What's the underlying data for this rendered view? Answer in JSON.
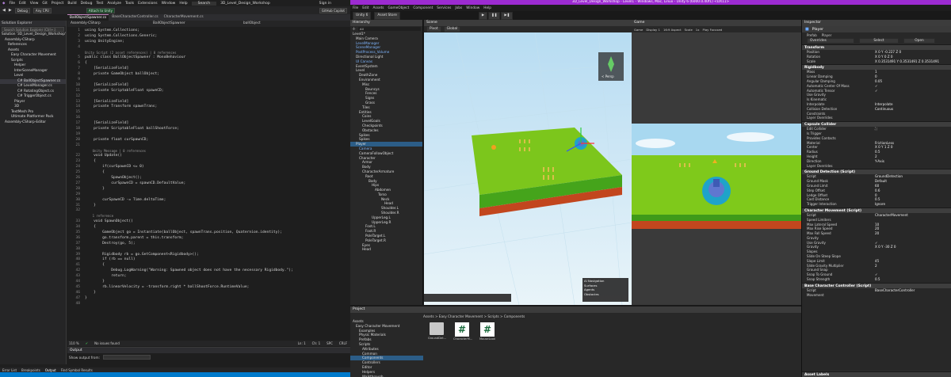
{
  "vs": {
    "title_menus": [
      "File",
      "Edit",
      "View",
      "Git",
      "Project",
      "Build",
      "Debug",
      "Test",
      "Analyze",
      "Tools",
      "Extensions",
      "Window",
      "Help"
    ],
    "search": "Search",
    "solution_name": "3D_Level_Design_Workshop",
    "sign_in": "Sign in",
    "toolbar": {
      "debug": "Debug",
      "cpu": "Any CPU",
      "attach": "Attach to Unity",
      "github": "GitHub Copilot"
    },
    "solution_explorer": {
      "title": "Solution Explorer",
      "search_placeholder": "Search Solution Explorer (Ctrl+;)",
      "tree": [
        {
          "d": 0,
          "t": "Solution '3D_Level_Design_Workshop'"
        },
        {
          "d": 1,
          "t": "Assembly-CSharp"
        },
        {
          "d": 2,
          "t": "References"
        },
        {
          "d": 2,
          "t": "Assets"
        },
        {
          "d": 3,
          "t": "Easy Character Movement"
        },
        {
          "d": 3,
          "t": "Scripts"
        },
        {
          "d": 4,
          "t": "Helper"
        },
        {
          "d": 4,
          "t": "InterSceneManager"
        },
        {
          "d": 4,
          "t": "Level"
        },
        {
          "d": 5,
          "t": "C# BallObjectSpawner.cs"
        },
        {
          "d": 5,
          "t": "C# LevelManager.cs"
        },
        {
          "d": 5,
          "t": "C# RotatingObject.cs"
        },
        {
          "d": 5,
          "t": "C# TriggerObject.cs"
        },
        {
          "d": 4,
          "t": "Player"
        },
        {
          "d": 4,
          "t": "3D"
        },
        {
          "d": 3,
          "t": "TextMesh Pro"
        },
        {
          "d": 3,
          "t": "Ultimate Platformer Pack"
        },
        {
          "d": 1,
          "t": "Assembly-CSharp-Editor"
        }
      ]
    },
    "tabs": [
      "BallObjectSpawner.cs",
      "BaseCharacterController.cs",
      "CharacterMovement.cs"
    ],
    "breadcrumb": [
      "Assembly-CSharp",
      "BallObjectSpawner",
      "ballObject"
    ],
    "code": [
      {
        "n": "1",
        "t": "using System.Collections;"
      },
      {
        "n": "2",
        "t": "using System.Collections.Generic;"
      },
      {
        "n": "3",
        "t": "using UnityEngine;"
      },
      {
        "n": "4",
        "t": ""
      },
      {
        "n": "",
        "t": "Unity Script (2 asset references) | 0 references",
        "hint": true
      },
      {
        "n": "5",
        "t": "public class BallObjectSpawner : MonoBehaviour"
      },
      {
        "n": "6",
        "t": "{"
      },
      {
        "n": "7",
        "t": "    [SerializeField]"
      },
      {
        "n": "8",
        "t": "    private GameObject ballObject;"
      },
      {
        "n": "9",
        "t": ""
      },
      {
        "n": "10",
        "t": "    [SerializeField]"
      },
      {
        "n": "11",
        "t": "    private ScriptableFloat spawnCD;"
      },
      {
        "n": "12",
        "t": ""
      },
      {
        "n": "13",
        "t": "    [SerializeField]"
      },
      {
        "n": "14",
        "t": "    private Transform spawnTrans;"
      },
      {
        "n": "15",
        "t": ""
      },
      {
        "n": "16",
        "t": ""
      },
      {
        "n": "17",
        "t": "    [SerializeField]"
      },
      {
        "n": "18",
        "t": "    private ScriptableFloat ballShootForce;"
      },
      {
        "n": "19",
        "t": ""
      },
      {
        "n": "20",
        "t": "    private float curSpawnCD;"
      },
      {
        "n": "21",
        "t": ""
      },
      {
        "n": "",
        "t": "    Unity Message | 0 references",
        "hint": true
      },
      {
        "n": "22",
        "t": "    void Update()"
      },
      {
        "n": "23",
        "t": "    {"
      },
      {
        "n": "24",
        "t": "        if(curSpawnCD <= 0)"
      },
      {
        "n": "25",
        "t": "        {"
      },
      {
        "n": "26",
        "t": "            SpawnObject();"
      },
      {
        "n": "27",
        "t": "            curSpawnCD = spawnCD.DefaultValue;"
      },
      {
        "n": "28",
        "t": "        }"
      },
      {
        "n": "29",
        "t": ""
      },
      {
        "n": "30",
        "t": "        curSpawnCD -= Time.deltaTime;"
      },
      {
        "n": "31",
        "t": "    }"
      },
      {
        "n": "32",
        "t": ""
      },
      {
        "n": "",
        "t": "    1 reference",
        "hint": true
      },
      {
        "n": "33",
        "t": "    void SpawnObject()"
      },
      {
        "n": "34",
        "t": "    {"
      },
      {
        "n": "35",
        "t": "        GameObject go = Instantiate(ballObject, spawnTrans.position, Quaternion.identity);"
      },
      {
        "n": "36",
        "t": "        go.transform.parent = this.transform;"
      },
      {
        "n": "37",
        "t": "        Destroy(go, 5);"
      },
      {
        "n": "38",
        "t": ""
      },
      {
        "n": "39",
        "t": "        Rigidbody rb = go.GetComponent<Rigidbody>();"
      },
      {
        "n": "40",
        "t": "        if (rb == null)"
      },
      {
        "n": "41",
        "t": "        {"
      },
      {
        "n": "42",
        "t": "            Debug.LogWarning(\"Warning: Spawned object does not have the necessary Rigidbody.\");"
      },
      {
        "n": "43",
        "t": "            return;"
      },
      {
        "n": "44",
        "t": "        }"
      },
      {
        "n": "45",
        "t": "        rb.linearVelocity = -transform.right * ballShootForce.RuntimeValue;"
      },
      {
        "n": "46",
        "t": "    }"
      },
      {
        "n": "47",
        "t": "}"
      },
      {
        "n": "48",
        "t": ""
      }
    ],
    "editor_status": {
      "zoom": "110 %",
      "issues": "No issues found",
      "pos": "Ln: 1",
      "ch": "Ch: 1",
      "spc": "SPC",
      "crlf": "CRLF"
    },
    "output": {
      "title": "Output",
      "show_from": "Show output from:"
    },
    "bottom_tabs": [
      "Error List",
      "Breakpoints",
      "Output",
      "Find Symbol Results"
    ]
  },
  "unity": {
    "title": "3D_Level_Design_Workshop - Level1 - Windows, Mac, Linux - Unity 6 (6000.0.40f1) <DX11>",
    "menus": [
      "File",
      "Edit",
      "Assets",
      "GameObject",
      "Component",
      "Services",
      "Jobs",
      "Window",
      "Help"
    ],
    "toolbar": {
      "account": "Unity 6",
      "asset_store": "Asset Store",
      "play": "▶",
      "pause": "❚❚",
      "step": "▶❚"
    },
    "hierarchy": {
      "title": "Hierarchy",
      "search": "All",
      "items": [
        {
          "d": 0,
          "t": "Level1*",
          "c": ""
        },
        {
          "d": 1,
          "t": "Main Camera",
          "c": ""
        },
        {
          "d": 1,
          "t": "LevelManager",
          "c": "pref"
        },
        {
          "d": 1,
          "t": "SceneManager",
          "c": "pref"
        },
        {
          "d": 1,
          "t": "PostProcess_Volume",
          "c": "pref"
        },
        {
          "d": 1,
          "t": "Directional Light",
          "c": ""
        },
        {
          "d": 1,
          "t": "UI Canvas",
          "c": "pref"
        },
        {
          "d": 1,
          "t": "EventSystem",
          "c": ""
        },
        {
          "d": 1,
          "t": "Level",
          "c": ""
        },
        {
          "d": 2,
          "t": "DeathZone",
          "c": ""
        },
        {
          "d": 2,
          "t": "Environment",
          "c": ""
        },
        {
          "d": 3,
          "t": "Misc",
          "c": ""
        },
        {
          "d": 4,
          "t": "Bouncys",
          "c": ""
        },
        {
          "d": 4,
          "t": "Fences",
          "c": ""
        },
        {
          "d": 4,
          "t": "Signs",
          "c": ""
        },
        {
          "d": 4,
          "t": "Grass",
          "c": ""
        },
        {
          "d": 3,
          "t": "Tiles",
          "c": ""
        },
        {
          "d": 2,
          "t": "Entities",
          "c": ""
        },
        {
          "d": 3,
          "t": "Coins",
          "c": ""
        },
        {
          "d": 3,
          "t": "LevelGoals",
          "c": ""
        },
        {
          "d": 3,
          "t": "Checkpoints",
          "c": ""
        },
        {
          "d": 3,
          "t": "Obstacles",
          "c": ""
        },
        {
          "d": 2,
          "t": "Spikes",
          "c": ""
        },
        {
          "d": 2,
          "t": "Spikes",
          "c": ""
        },
        {
          "d": 1,
          "t": "Player",
          "c": "sel"
        },
        {
          "d": 2,
          "t": "Camera",
          "c": "pref"
        },
        {
          "d": 2,
          "t": "CameraFollowObject",
          "c": ""
        },
        {
          "d": 2,
          "t": "Character",
          "c": ""
        },
        {
          "d": 3,
          "t": "Armor",
          "c": ""
        },
        {
          "d": 3,
          "t": "Body",
          "c": ""
        },
        {
          "d": 3,
          "t": "CharacterArmature",
          "c": ""
        },
        {
          "d": 4,
          "t": "Root",
          "c": ""
        },
        {
          "d": 5,
          "t": "Body",
          "c": ""
        },
        {
          "d": 6,
          "t": "Hips",
          "c": ""
        },
        {
          "d": 7,
          "t": "Abdomen",
          "c": ""
        },
        {
          "d": 8,
          "t": "Torso",
          "c": ""
        },
        {
          "d": 9,
          "t": "Neck",
          "c": ""
        },
        {
          "d": 10,
          "t": "Head",
          "c": ""
        },
        {
          "d": 9,
          "t": "Shoulder.L",
          "c": ""
        },
        {
          "d": 9,
          "t": "Shoulder.R",
          "c": ""
        },
        {
          "d": 6,
          "t": "UpperLeg.L",
          "c": ""
        },
        {
          "d": 6,
          "t": "UpperLeg.R",
          "c": ""
        },
        {
          "d": 4,
          "t": "Foot.L",
          "c": ""
        },
        {
          "d": 4,
          "t": "Foot.R",
          "c": ""
        },
        {
          "d": 4,
          "t": "PoleTarget.L",
          "c": ""
        },
        {
          "d": 4,
          "t": "PoleTarget.R",
          "c": ""
        },
        {
          "d": 3,
          "t": "Eyes",
          "c": ""
        },
        {
          "d": 3,
          "t": "Head",
          "c": ""
        }
      ]
    },
    "scene": {
      "tab": "Scene",
      "pivot": "Pivot",
      "global": "Global",
      "persp": "< Persp",
      "nav": {
        "title": "AI Navigation",
        "items": [
          "Surfaces",
          "Agents",
          "Obstacles"
        ]
      }
    },
    "game": {
      "tab": "Game",
      "display": "Game",
      "display_n": "Display 1",
      "aspect": "16:9 Aspect",
      "scale": "Scale",
      "scale_val": "1x",
      "play_focused": "Play Focused"
    },
    "project": {
      "title": "Project",
      "breadcrumb": "Assets > Easy Character Movement > Scripts > Components",
      "tree": [
        "Assets",
        "Easy Character Movement",
        "Examples",
        "Physic Materials",
        "Prefabs",
        "Scripts",
        "Attributes",
        "Common",
        "Components",
        "Controllers",
        "Editor",
        "Helpers",
        "Walkthrough"
      ],
      "files": [
        "GroundDet...",
        "CharacterM...",
        "MouseLook"
      ]
    },
    "inspector": {
      "title": "Inspector",
      "object": "Player",
      "prefab_label": "Prefab",
      "prefab_name": "Player",
      "overrides": "Overrides",
      "select": "Select",
      "open": "Open",
      "transform": {
        "title": "Transform",
        "position": [
          "0",
          "-0.227",
          "0"
        ],
        "rotation": [
          "0",
          "0",
          "0"
        ],
        "scale": [
          "0.3531491",
          "0.3531491",
          "0.3531491"
        ]
      },
      "rigidbody": {
        "title": "Rigidbody",
        "rows": [
          [
            "Mass",
            "1"
          ],
          [
            "Linear Damping",
            "0"
          ],
          [
            "Angular Damping",
            "0.05"
          ],
          [
            "Automatic Center Of Mass",
            "✓"
          ],
          [
            "Automatic Tensor",
            "✓"
          ],
          [
            "Use Gravity",
            ""
          ],
          [
            "Is Kinematic",
            ""
          ],
          [
            "Interpolate",
            "Interpolate"
          ],
          [
            "Collision Detection",
            "Continuous"
          ],
          [
            "Constraints",
            ""
          ],
          [
            "Layer Overrides",
            ""
          ]
        ]
      },
      "capsule": {
        "title": "Capsule Collider",
        "rows": [
          [
            "Edit Collider",
            "⛶"
          ],
          [
            "Is Trigger",
            ""
          ],
          [
            "Provides Contacts",
            ""
          ],
          [
            "Material",
            "FrictionLess"
          ],
          [
            "Center",
            "X 0   Y 1   Z 0"
          ],
          [
            "Radius",
            "0.5"
          ],
          [
            "Height",
            "2"
          ],
          [
            "Direction",
            "Y-Axis"
          ],
          [
            "Layer Overrides",
            ""
          ]
        ]
      },
      "ground": {
        "title": "Ground Detection (Script)",
        "rows": [
          [
            "Script",
            "GroundDetection"
          ],
          [
            "Ground Mask",
            "Default"
          ],
          [
            "Ground Limit",
            "60"
          ],
          [
            "Step Offset",
            "0.6"
          ],
          [
            "Ledge Offset",
            "0"
          ],
          [
            "Cast Distance",
            "0.5"
          ],
          [
            "Trigger Interaction",
            "Ignore"
          ]
        ]
      },
      "charmove": {
        "title": "Character Movement (Script)",
        "rows": [
          [
            "Script",
            "CharacterMovement"
          ],
          [
            "Speed Limiters",
            ""
          ],
          [
            "Max Lateral Speed",
            "10"
          ],
          [
            "Max Rise Speed",
            "20"
          ],
          [
            "Max Fall Speed",
            "20"
          ],
          [
            "Gravity",
            ""
          ],
          [
            "Use Gravity",
            "✓"
          ],
          [
            "Gravity",
            "X 0   Y -30   Z 0"
          ],
          [
            "Slopes",
            ""
          ],
          [
            "Slide On Steep Slope",
            ""
          ],
          [
            "Slope Limit",
            "45"
          ],
          [
            "Slide Gravity Multiplier",
            "2"
          ],
          [
            "Ground Snap",
            ""
          ],
          [
            "Snap To Ground",
            "✓"
          ],
          [
            "Snap Strength",
            "0.5"
          ]
        ]
      },
      "basechar": {
        "title": "Base Character Controller (Script)",
        "rows": [
          [
            "Script",
            "BaseCharacterController"
          ],
          [
            "Movement",
            ""
          ]
        ]
      },
      "asset_labels": "Asset Labels"
    }
  }
}
